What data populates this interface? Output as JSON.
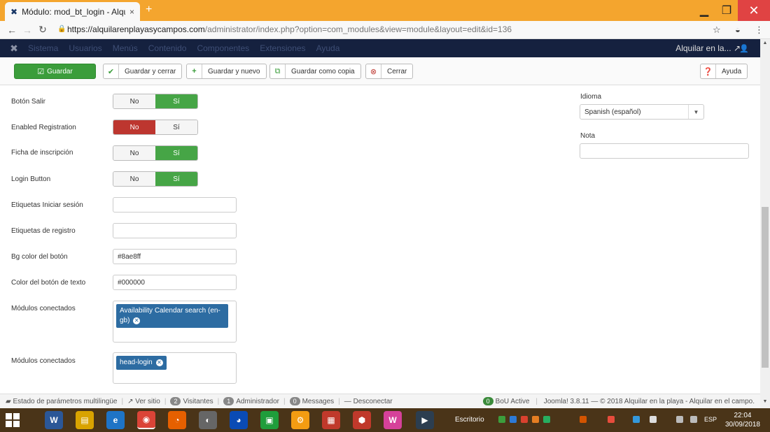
{
  "browser": {
    "tab_title": "Módulo: mod_bt_login - Alquilar",
    "tab_close": "×",
    "new_tab": "+",
    "url_host": "https://alquilarenplayasycampos.com",
    "url_path": "/administrator/index.php?option=com_modules&view=module&layout=edit&id=136"
  },
  "adminnav": {
    "menus": [
      "Sistema",
      "Usuarios",
      "Menús",
      "Contenido",
      "Componentes",
      "Extensiones",
      "Ayuda"
    ],
    "site_link": "Alquilar en la..."
  },
  "toolbar": {
    "save": "Guardar",
    "save_close": "Guardar y cerrar",
    "save_new": "Guardar y nuevo",
    "save_copy": "Guardar como copia",
    "close": "Cerrar",
    "help": "Ayuda"
  },
  "form": {
    "toggle_no": "No",
    "toggle_yes": "Sí",
    "fields": [
      {
        "label": "Botón Salir",
        "state": "yes"
      },
      {
        "label": "Enabled Registration",
        "state": "no"
      },
      {
        "label": "Ficha de inscripción",
        "state": "yes"
      },
      {
        "label": "Login Button",
        "state": "yes"
      }
    ],
    "label_login": "Etiquetas Iniciar sesión",
    "label_register": "Etiquetas de registro",
    "label_bg": "Bg color del botón",
    "value_bg": "#8ae8ff",
    "label_text_color": "Color del botón de texto",
    "value_text_color": "#000000",
    "label_modules1": "Módulos conectados",
    "chip_modules1": "Availability Calendar search (en-gb)",
    "label_modules2": "Módulos conectados",
    "chip_modules2": "head-login"
  },
  "sidebar": {
    "language_label": "Idioma",
    "language_value": "Spanish (español)",
    "note_label": "Nota"
  },
  "statusbar": {
    "multilang": "Estado de parámetros multilingüe",
    "view_site": "Ver sitio",
    "visitors_count": "2",
    "visitors": "Visitantes",
    "admin_count": "1",
    "admin": "Administrador",
    "messages_count": "0",
    "messages": "Messages",
    "logout": "Desconectar",
    "bou_count": "0",
    "bou": "BoU Active",
    "joomla": "Joomla! 3.8.11 — © 2018 Alquilar en la playa - Alquilar en el campo."
  },
  "taskbar": {
    "desktop": "Escritorio",
    "lang": "ESP",
    "time": "22:04",
    "date": "30/09/2018"
  }
}
